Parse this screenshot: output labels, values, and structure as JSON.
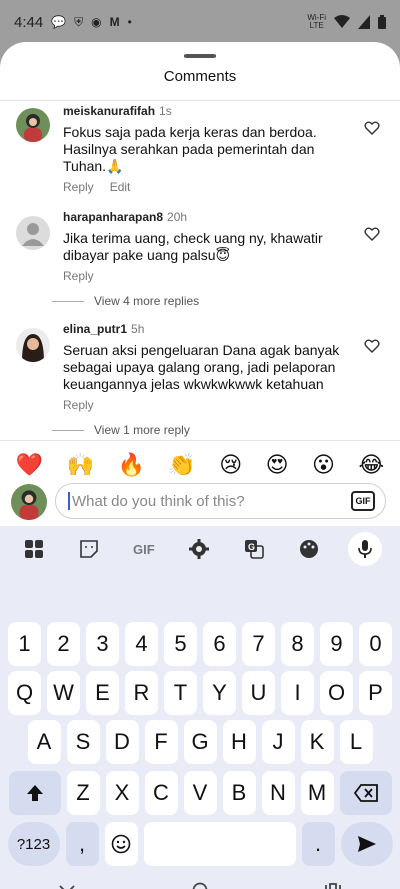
{
  "status_bar": {
    "time": "4:44",
    "volte_top": "Wi-Fi",
    "volte_bottom": "LTE"
  },
  "sheet": {
    "title": "Comments"
  },
  "comments": [
    {
      "user": "meiskanurafifah",
      "time": "1s",
      "text": "Fokus saja pada kerja keras dan berdoa. Hasilnya serahkan pada pemerintah dan Tuhan.🙏",
      "reply_label": "Reply",
      "edit_label": "Edit"
    },
    {
      "user": "harapanharapan8",
      "time": "20h",
      "text": "Jika terima uang, check uang ny, khawatir dibayar pake uang palsu😇",
      "reply_label": "Reply",
      "view_replies": "View 4 more replies"
    },
    {
      "user": "elina_putr1",
      "time": "5h",
      "text": "Seruan aksi pengeluaran Dana agak banyak sebagai upaya galang orang, jadi pelaporan keuangannya jelas wkwkwkwwk ketahuan",
      "reply_label": "Reply",
      "view_replies": "View 1 more reply"
    }
  ],
  "emoji_reactions": [
    "❤️",
    "🙌",
    "🔥",
    "👏",
    "😢",
    "😍",
    "😮",
    "😂"
  ],
  "compose": {
    "placeholder": "What do you think of this?",
    "gif_label": "GIF"
  },
  "keyboard": {
    "toolbar_gif": "GIF",
    "row_numbers": [
      "1",
      "2",
      "3",
      "4",
      "5",
      "6",
      "7",
      "8",
      "9",
      "0"
    ],
    "row_1": [
      "Q",
      "W",
      "E",
      "R",
      "T",
      "Y",
      "U",
      "I",
      "O",
      "P"
    ],
    "row_2": [
      "A",
      "S",
      "D",
      "F",
      "G",
      "H",
      "J",
      "K",
      "L"
    ],
    "row_3": [
      "Z",
      "X",
      "C",
      "V",
      "B",
      "N",
      "M"
    ],
    "symbols_label": "?123",
    "comma": ",",
    "period": "."
  },
  "colors": {
    "accent": "#3b5bdb",
    "keyboard_bg": "#e9ecf6",
    "special_key": "#d6dcef"
  },
  "icons": [
    "wifi-icon",
    "signal-icon",
    "battery-icon",
    "heart-outline-icon",
    "grid-icon",
    "sticker-icon",
    "settings-icon",
    "translate-icon",
    "palette-icon",
    "mic-icon",
    "shift-icon",
    "backspace-icon",
    "emoji-icon",
    "send-icon",
    "nav-back-icon",
    "nav-home-icon",
    "nav-recents-icon"
  ]
}
